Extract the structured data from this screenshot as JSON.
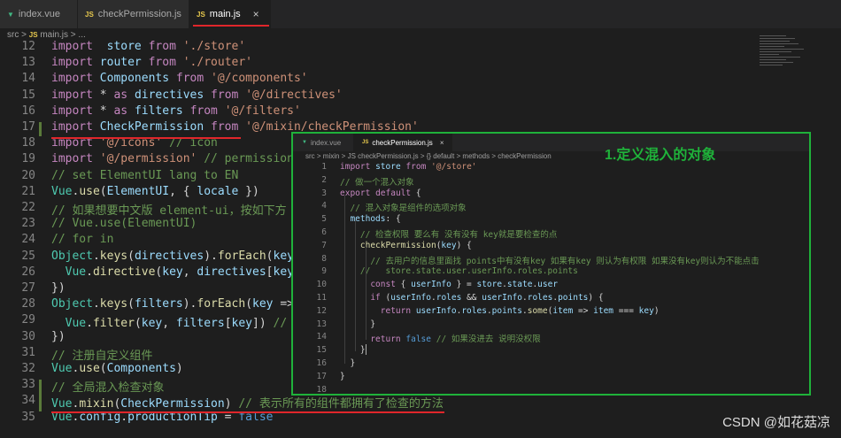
{
  "tabs": [
    {
      "icon": "vue",
      "label": "index.vue",
      "active": false
    },
    {
      "icon": "js",
      "label": "checkPermission.js",
      "active": false
    },
    {
      "icon": "js",
      "label": "main.js",
      "active": true,
      "close": "×"
    }
  ],
  "breadcrumb": {
    "src": "src",
    "sep": ">",
    "js": "JS",
    "file": "main.js",
    "rest": "> ..."
  },
  "main_code": [
    {
      "n": "12",
      "t": [
        [
          "kw",
          "import"
        ],
        [
          "",
          "  "
        ],
        [
          "id",
          "store"
        ],
        [
          "",
          " "
        ],
        [
          "kw",
          "from"
        ],
        [
          "",
          " "
        ],
        [
          "str",
          "'./store'"
        ]
      ]
    },
    {
      "n": "13",
      "t": [
        [
          "kw",
          "import"
        ],
        [
          "",
          " "
        ],
        [
          "id",
          "router"
        ],
        [
          "",
          " "
        ],
        [
          "kw",
          "from"
        ],
        [
          "",
          " "
        ],
        [
          "str",
          "'./router'"
        ]
      ]
    },
    {
      "n": "14",
      "t": [
        [
          "kw",
          "import"
        ],
        [
          "",
          " "
        ],
        [
          "id",
          "Components"
        ],
        [
          "",
          " "
        ],
        [
          "kw",
          "from"
        ],
        [
          "",
          " "
        ],
        [
          "str",
          "'@/components'"
        ]
      ]
    },
    {
      "n": "15",
      "t": [
        [
          "kw",
          "import"
        ],
        [
          "",
          " "
        ],
        [
          "",
          "*"
        ],
        [
          "",
          " "
        ],
        [
          "kw",
          "as"
        ],
        [
          "",
          " "
        ],
        [
          "id",
          "directives"
        ],
        [
          "",
          " "
        ],
        [
          "kw",
          "from"
        ],
        [
          "",
          " "
        ],
        [
          "str",
          "'@/directives'"
        ]
      ]
    },
    {
      "n": "16",
      "t": [
        [
          "kw",
          "import"
        ],
        [
          "",
          " "
        ],
        [
          "",
          "*"
        ],
        [
          "",
          " "
        ],
        [
          "kw",
          "as"
        ],
        [
          "",
          " "
        ],
        [
          "id",
          "filters"
        ],
        [
          "",
          " "
        ],
        [
          "kw",
          "from"
        ],
        [
          "",
          " "
        ],
        [
          "str",
          "'@/filters'"
        ]
      ]
    },
    {
      "n": "17",
      "t": [
        [
          "kw",
          "import"
        ],
        [
          "",
          " "
        ],
        [
          "id",
          "CheckPermission"
        ],
        [
          "",
          " "
        ],
        [
          "kw",
          "from"
        ],
        [
          "",
          " "
        ],
        [
          "str",
          "'@/mixin/checkPermission'"
        ]
      ]
    },
    {
      "n": "18",
      "t": [
        [
          "kw",
          "import"
        ],
        [
          "",
          " "
        ],
        [
          "str",
          "'@/icons'"
        ],
        [
          "",
          " "
        ],
        [
          "cm",
          "// icon"
        ]
      ]
    },
    {
      "n": "19",
      "t": [
        [
          "kw",
          "import"
        ],
        [
          "",
          " "
        ],
        [
          "str",
          "'@/permission'"
        ],
        [
          "",
          " "
        ],
        [
          "cm",
          "// permission"
        ]
      ]
    },
    {
      "n": "20",
      "t": [
        [
          "cm",
          "// set ElementUI lang to EN"
        ]
      ]
    },
    {
      "n": "21",
      "t": [
        [
          "cls",
          "Vue"
        ],
        [
          "",
          "."
        ],
        [
          "fn",
          "use"
        ],
        [
          "",
          "("
        ],
        [
          "id",
          "ElementUI"
        ],
        [
          "",
          ", { "
        ],
        [
          "id",
          "locale"
        ],
        [
          "",
          " })"
        ]
      ]
    },
    {
      "n": "22",
      "t": [
        [
          "cm",
          "// 如果想要中文版 element-ui，按如下方"
        ]
      ]
    },
    {
      "n": "23",
      "t": [
        [
          "cm",
          "// Vue.use(ElementUI)"
        ]
      ]
    },
    {
      "n": "24",
      "t": [
        [
          "cm",
          "// for in"
        ]
      ]
    },
    {
      "n": "25",
      "t": [
        [
          "cls",
          "Object"
        ],
        [
          "",
          "."
        ],
        [
          "fn",
          "keys"
        ],
        [
          "",
          "("
        ],
        [
          "id",
          "directives"
        ],
        [
          "",
          ")."
        ],
        [
          "fn",
          "forEach"
        ],
        [
          "",
          "("
        ],
        [
          "id",
          "key"
        ]
      ]
    },
    {
      "n": "26",
      "t": [
        [
          "",
          "  "
        ],
        [
          "cls",
          "Vue"
        ],
        [
          "",
          "."
        ],
        [
          "fn",
          "directive"
        ],
        [
          "",
          "("
        ],
        [
          "id",
          "key"
        ],
        [
          "",
          ", "
        ],
        [
          "id",
          "directives"
        ],
        [
          "",
          "["
        ],
        [
          "id",
          "key"
        ],
        [
          "",
          "]"
        ]
      ]
    },
    {
      "n": "27",
      "t": [
        [
          "",
          "})"
        ]
      ]
    },
    {
      "n": "28",
      "t": [
        [
          "cls",
          "Object"
        ],
        [
          "",
          "."
        ],
        [
          "fn",
          "keys"
        ],
        [
          "",
          "("
        ],
        [
          "id",
          "filters"
        ],
        [
          "",
          ")."
        ],
        [
          "fn",
          "forEach"
        ],
        [
          "",
          "("
        ],
        [
          "id",
          "key"
        ],
        [
          "",
          " =>"
        ]
      ]
    },
    {
      "n": "29",
      "t": [
        [
          "",
          "  "
        ],
        [
          "cls",
          "Vue"
        ],
        [
          "",
          "."
        ],
        [
          "fn",
          "filter"
        ],
        [
          "",
          "("
        ],
        [
          "id",
          "key"
        ],
        [
          "",
          ", "
        ],
        [
          "id",
          "filters"
        ],
        [
          "",
          "["
        ],
        [
          "id",
          "key"
        ],
        [
          "",
          "]) "
        ],
        [
          "cm",
          "// 注"
        ]
      ]
    },
    {
      "n": "30",
      "t": [
        [
          "",
          "})"
        ]
      ]
    },
    {
      "n": "31",
      "t": [
        [
          "cm",
          "// 注册自定义组件"
        ]
      ]
    },
    {
      "n": "32",
      "t": [
        [
          "cls",
          "Vue"
        ],
        [
          "",
          "."
        ],
        [
          "fn",
          "use"
        ],
        [
          "",
          "("
        ],
        [
          "id",
          "Components"
        ],
        [
          "",
          ")"
        ]
      ]
    },
    {
      "n": "33",
      "t": [
        [
          "cm",
          "// 全局混入检查对象"
        ]
      ]
    },
    {
      "n": "34",
      "t": [
        [
          "cls",
          "Vue"
        ],
        [
          "",
          "."
        ],
        [
          "fn",
          "mixin"
        ],
        [
          "",
          "("
        ],
        [
          "id",
          "CheckPermission"
        ],
        [
          "",
          ") "
        ],
        [
          "cm",
          "// 表示所有的组件都拥有了检查的方法"
        ]
      ]
    },
    {
      "n": "35",
      "t": [
        [
          "cls",
          "Vue"
        ],
        [
          "",
          "."
        ],
        [
          "id",
          "config"
        ],
        [
          "",
          "."
        ],
        [
          "id",
          "productionTip"
        ],
        [
          "",
          " = "
        ],
        [
          "bool",
          "false"
        ]
      ]
    }
  ],
  "overlay": {
    "title": "1.定义混入的对象",
    "tabs": [
      {
        "icon": "vue",
        "label": "index.vue",
        "active": false
      },
      {
        "icon": "js",
        "label": "checkPermission.js",
        "active": true,
        "close": "×"
      }
    ],
    "breadcrumb": "src > mixin > JS checkPermission.js > {} default > methods > checkPermission",
    "code": [
      {
        "n": "1",
        "t": [
          [
            "kw",
            "import"
          ],
          [
            "",
            " "
          ],
          [
            "id",
            "store"
          ],
          [
            "",
            " "
          ],
          [
            "kw",
            "from"
          ],
          [
            "",
            " "
          ],
          [
            "str",
            "'@/store'"
          ]
        ]
      },
      {
        "n": "2",
        "t": [
          [
            "cm",
            "// 做一个混入对象"
          ]
        ]
      },
      {
        "n": "3",
        "t": [
          [
            "kw",
            "export"
          ],
          [
            "",
            " "
          ],
          [
            "kw",
            "default"
          ],
          [
            "",
            " {"
          ]
        ]
      },
      {
        "n": "4",
        "t": [
          [
            "",
            "  "
          ],
          [
            "cm",
            "// 混入对象是组件的选项对象"
          ]
        ]
      },
      {
        "n": "5",
        "t": [
          [
            "",
            "  "
          ],
          [
            "id",
            "methods"
          ],
          [
            "",
            ": {"
          ]
        ]
      },
      {
        "n": "6",
        "t": [
          [
            "",
            "    "
          ],
          [
            "cm",
            "// 检查权限 要么有 没有没有 key就是要检查的点"
          ]
        ]
      },
      {
        "n": "7",
        "t": [
          [
            "",
            "    "
          ],
          [
            "fn",
            "checkPermission"
          ],
          [
            "",
            "("
          ],
          [
            "id",
            "key"
          ],
          [
            "",
            ") {"
          ]
        ]
      },
      {
        "n": "8",
        "t": [
          [
            "",
            "      "
          ],
          [
            "cm",
            "// 去用户的信息里面找 points中有没有key 如果有key 则认为有权限 如果没有key则认为不能点击"
          ]
        ]
      },
      {
        "n": "9",
        "t": [
          [
            "",
            "    "
          ],
          [
            "cm",
            "//   store.state.user.userInfo.roles.points"
          ]
        ]
      },
      {
        "n": "10",
        "t": [
          [
            "",
            "      "
          ],
          [
            "kw",
            "const"
          ],
          [
            "",
            " { "
          ],
          [
            "id",
            "userInfo"
          ],
          [
            "",
            " } = "
          ],
          [
            "id",
            "store"
          ],
          [
            "",
            "."
          ],
          [
            "id",
            "state"
          ],
          [
            "",
            "."
          ],
          [
            "id",
            "user"
          ]
        ]
      },
      {
        "n": "11",
        "t": [
          [
            "",
            "      "
          ],
          [
            "kw",
            "if"
          ],
          [
            "",
            " ("
          ],
          [
            "id",
            "userInfo"
          ],
          [
            "",
            "."
          ],
          [
            "id",
            "roles"
          ],
          [
            "",
            " && "
          ],
          [
            "id",
            "userInfo"
          ],
          [
            "",
            "."
          ],
          [
            "id",
            "roles"
          ],
          [
            "",
            "."
          ],
          [
            "id",
            "points"
          ],
          [
            "",
            ") {"
          ]
        ]
      },
      {
        "n": "12",
        "t": [
          [
            "",
            "        "
          ],
          [
            "kw",
            "return"
          ],
          [
            "",
            " "
          ],
          [
            "id",
            "userInfo"
          ],
          [
            "",
            "."
          ],
          [
            "id",
            "roles"
          ],
          [
            "",
            "."
          ],
          [
            "id",
            "points"
          ],
          [
            "",
            "."
          ],
          [
            "fn",
            "some"
          ],
          [
            "",
            "("
          ],
          [
            "id",
            "item"
          ],
          [
            "",
            " => "
          ],
          [
            "id",
            "item"
          ],
          [
            "",
            " === "
          ],
          [
            "id",
            "key"
          ],
          [
            "",
            ")"
          ]
        ]
      },
      {
        "n": "13",
        "t": [
          [
            "",
            "      }"
          ]
        ]
      },
      {
        "n": "14",
        "t": [
          [
            "",
            "      "
          ],
          [
            "kw",
            "return"
          ],
          [
            "",
            " "
          ],
          [
            "bool",
            "false"
          ],
          [
            "",
            " "
          ],
          [
            "cm",
            "// 如果没进去 说明没权限"
          ]
        ]
      },
      {
        "n": "15",
        "t": [
          [
            "",
            "    }"
          ]
        ]
      },
      {
        "n": "16",
        "t": [
          [
            "",
            "  }"
          ]
        ]
      },
      {
        "n": "17",
        "t": [
          [
            "",
            "}"
          ]
        ]
      },
      {
        "n": "18",
        "t": []
      }
    ]
  },
  "watermark": "CSDN @如花菇凉"
}
